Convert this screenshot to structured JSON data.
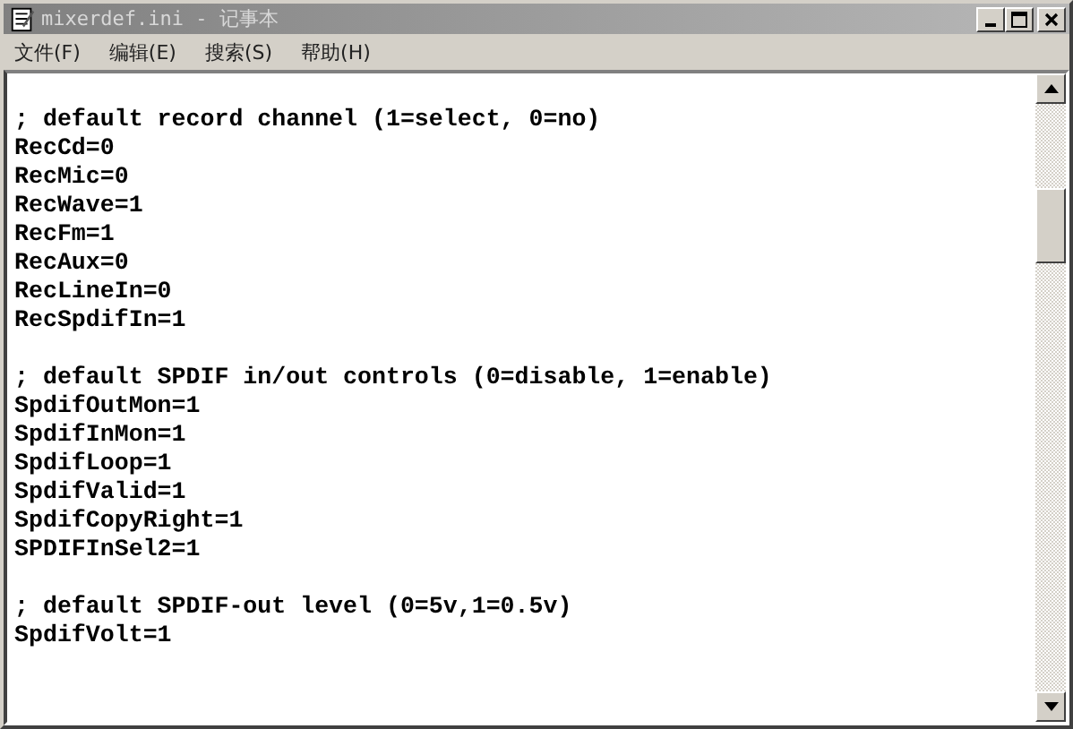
{
  "window": {
    "title": "mixerdef.ini - 记事本"
  },
  "menu": [
    {
      "label": "文件(F)"
    },
    {
      "label": "编辑(E)"
    },
    {
      "label": "搜索(S)"
    },
    {
      "label": "帮助(H)"
    }
  ],
  "editor": {
    "blocks": [
      [
        "; default record channel (1=select, 0=no)",
        "RecCd=0",
        "RecMic=0",
        "RecWave=1",
        "RecFm=1",
        "RecAux=0",
        "RecLineIn=0",
        "RecSpdifIn=1"
      ],
      [
        "; default SPDIF in/out controls (0=disable, 1=enable)",
        "SpdifOutMon=1",
        "SpdifInMon=1",
        "SpdifLoop=1",
        "SpdifValid=1",
        "SpdifCopyRight=1",
        "SPDIFInSel2=1"
      ],
      [
        "; default SPDIF-out level (0=5v,1=0.5v)",
        "SpdifVolt=1"
      ]
    ]
  }
}
